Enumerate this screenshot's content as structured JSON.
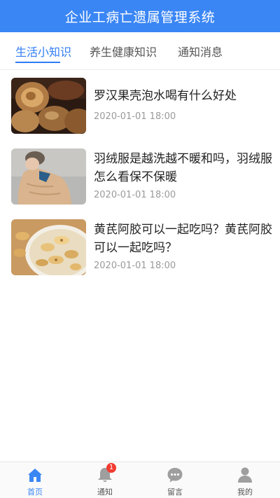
{
  "header": {
    "title": "企业工病亡遗属管理系统"
  },
  "tabs": [
    {
      "label": "生活小知识",
      "active": true
    },
    {
      "label": "养生健康知识",
      "active": false
    },
    {
      "label": "通知消息",
      "active": false
    }
  ],
  "articles": [
    {
      "title": "罗汉果壳泡水喝有什么好处",
      "date": "2020-01-01 18:00"
    },
    {
      "title": "羽绒服是越洗越不暖和吗，羽绒服怎么看保不保暖",
      "date": "2020-01-01 18:00"
    },
    {
      "title": "黄芪阿胶可以一起吃吗？黄芪阿胶可以一起吃吗？",
      "date": "2020-01-01 18:00"
    }
  ],
  "tabbar": {
    "items": [
      {
        "label": "首页",
        "icon": "home-icon",
        "active": true
      },
      {
        "label": "通知",
        "icon": "bell-icon",
        "badge": "1"
      },
      {
        "label": "留言",
        "icon": "chat-icon"
      },
      {
        "label": "我的",
        "icon": "user-icon"
      }
    ]
  },
  "colors": {
    "primary": "#3a86f5",
    "badge": "#f23b30"
  }
}
